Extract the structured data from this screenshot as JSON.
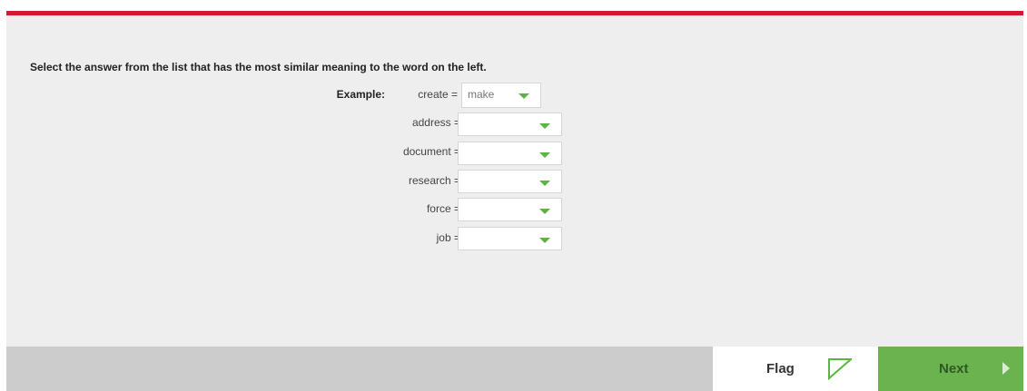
{
  "instructions": "Select the answer from the list that has the most similar meaning to the word on the left.",
  "example": {
    "label": "Example:",
    "word": "create =",
    "answer": "make"
  },
  "questions": [
    {
      "word": "address =",
      "answer": ""
    },
    {
      "word": "document =",
      "answer": ""
    },
    {
      "word": "research =",
      "answer": ""
    },
    {
      "word": "force =",
      "answer": ""
    },
    {
      "word": "job =",
      "answer": ""
    }
  ],
  "footer": {
    "flag_label": "Flag",
    "next_label": "Next"
  },
  "colors": {
    "accent_red": "#d6172e",
    "accent_green": "#6ab34f",
    "caret_green": "#5cb443",
    "background": "#eeeeee",
    "footer_bg": "#cccccc"
  }
}
